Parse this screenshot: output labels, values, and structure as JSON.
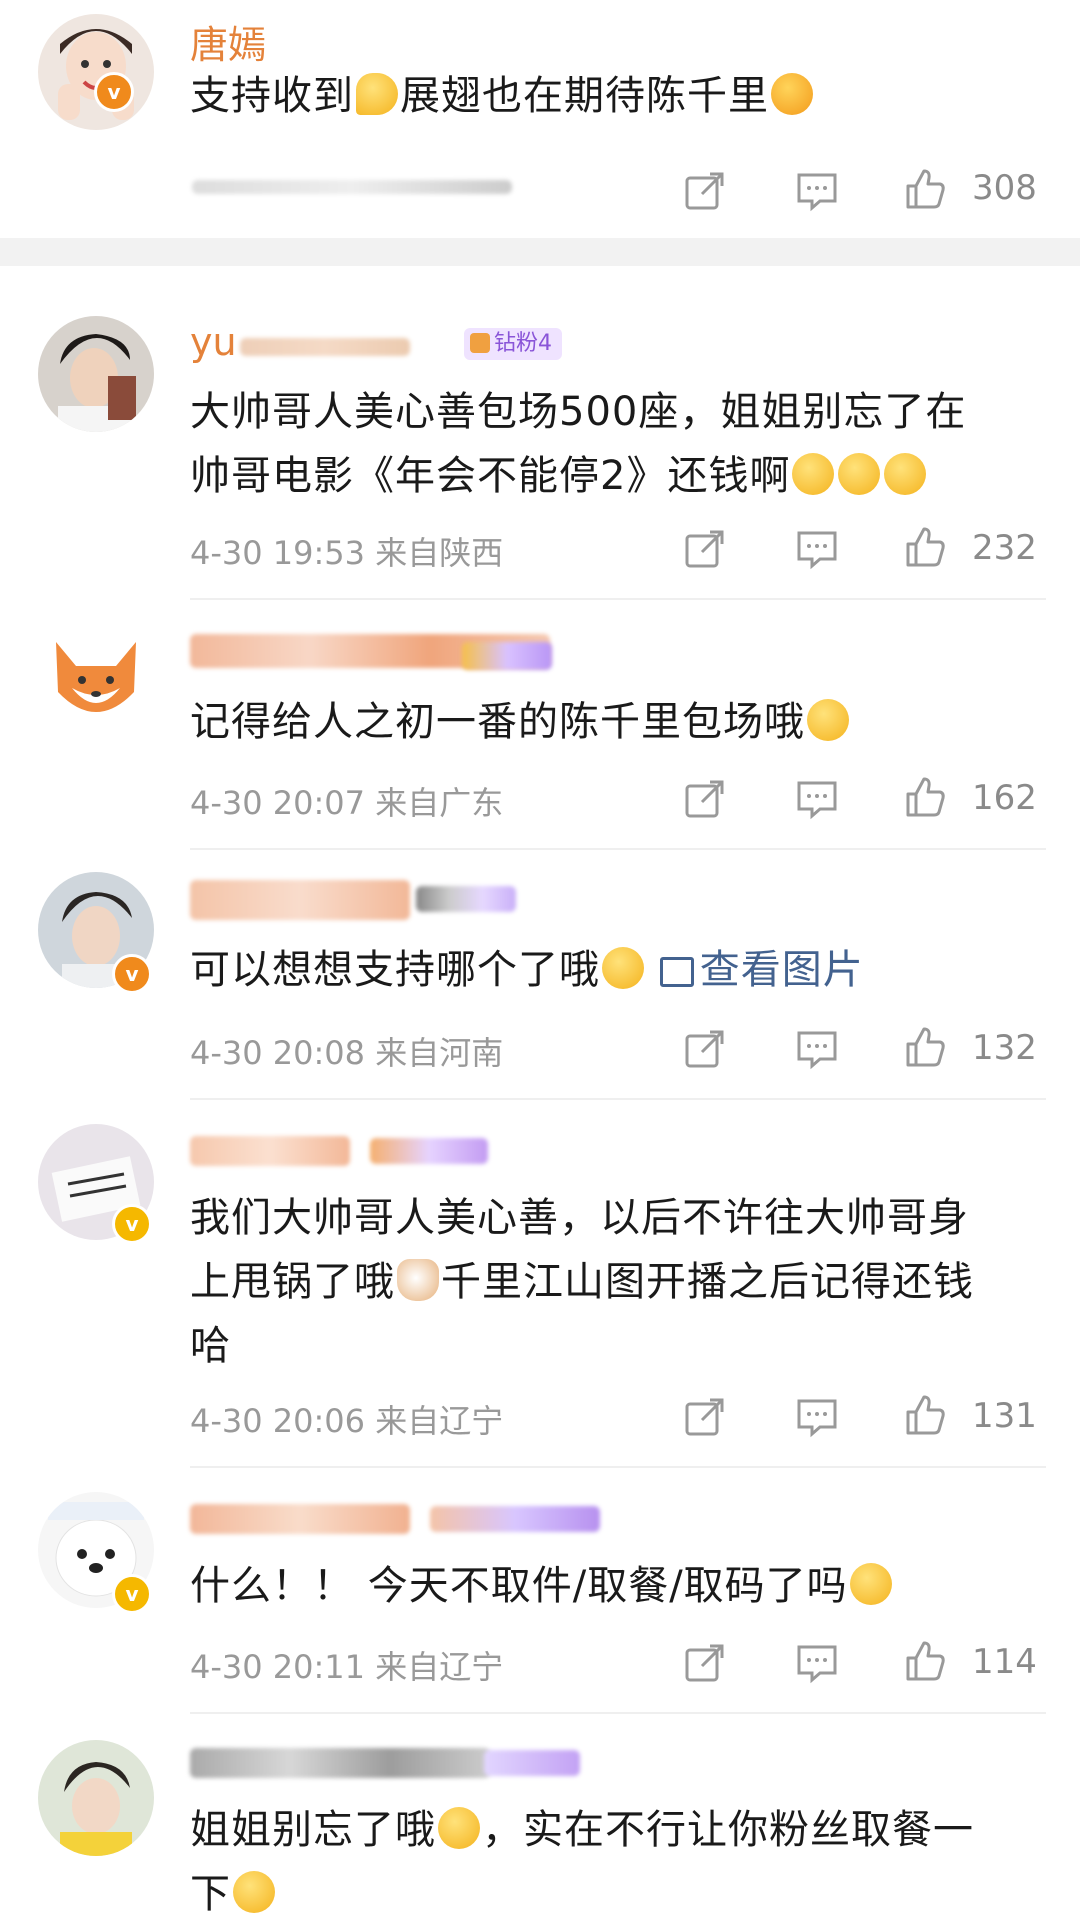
{
  "comments": [
    {
      "username": "唐嫣",
      "text_parts": [
        "支持收到",
        "展翅也在期待陈千里"
      ],
      "likes": "308",
      "verified": "orange"
    },
    {
      "username_partial": "yu",
      "fan_badge": "钻粉4",
      "text_line1": "大帅哥人美心善包场500座，姐姐别忘了在",
      "text_line2": "帅哥电影《年会不能停2》还钱啊",
      "time": "4-30 19:53 来自陕西",
      "likes": "232"
    },
    {
      "text": "记得给人之初一番的陈千里包场哦",
      "time": "4-30 20:07 来自广东",
      "likes": "162"
    },
    {
      "text": "可以想想支持哪个了哦",
      "view_image": "查看图片",
      "time": "4-30 20:08 来自河南",
      "likes": "132",
      "verified": "orange"
    },
    {
      "text_line1": "我们大帅哥人美心善，以后不许往大帅哥身",
      "text_line2_a": "上甩锅了哦",
      "text_line2_b": "千里江山图开播之后记得还钱",
      "text_line3": "哈",
      "time": "4-30 20:06 来自辽宁",
      "likes": "131",
      "verified": "gold"
    },
    {
      "text": "什么！！ 今天不取件/取餐/取码了吗",
      "time": "4-30 20:11 来自辽宁",
      "likes": "114",
      "verified": "gold"
    },
    {
      "text_line1_a": "姐姐别忘了哦",
      "text_line1_b": "，实在不行让你粉丝取餐一",
      "text_line2": "下"
    }
  ],
  "icons": {
    "share": "share-icon",
    "comment": "comment-icon",
    "like": "thumbs-up-icon",
    "image": "image-icon"
  },
  "colors": {
    "username": "#e4823a",
    "meta": "#999999",
    "link": "#43628f",
    "verified_orange": "#f08a1c",
    "verified_gold": "#f5b800",
    "fan_badge": "#8a55d8"
  }
}
